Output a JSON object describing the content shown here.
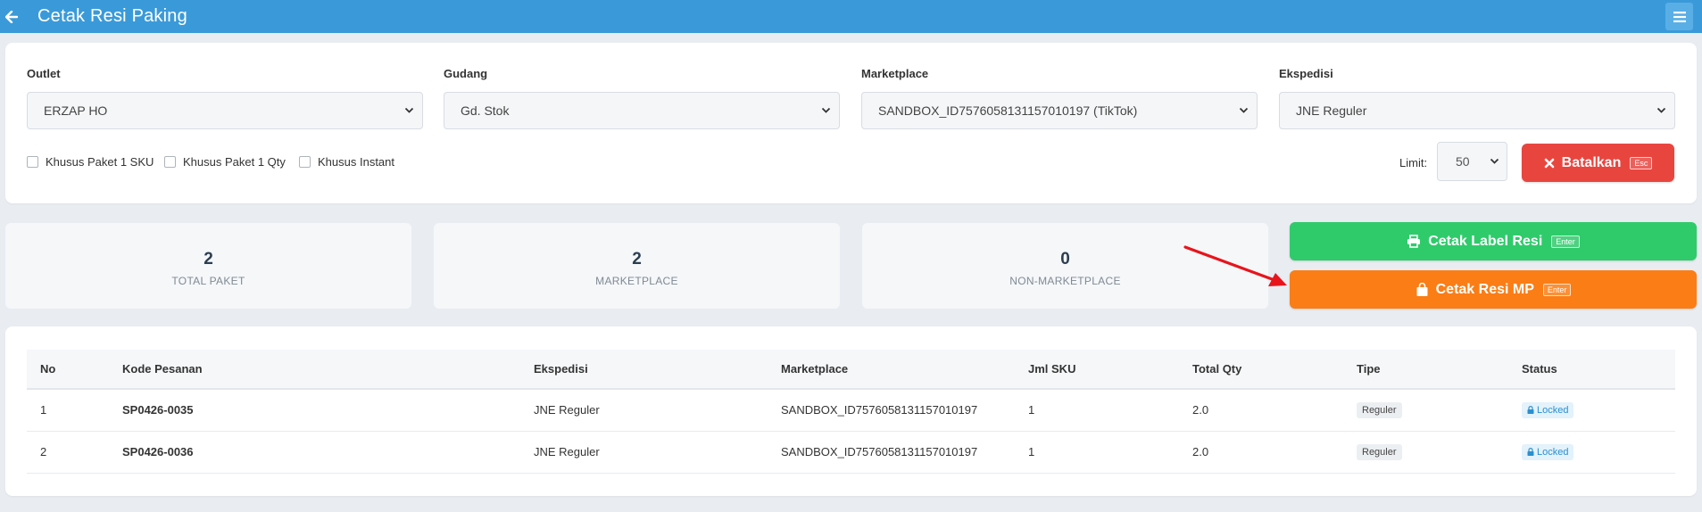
{
  "header": {
    "title": "Cetak Resi Paking"
  },
  "filters": {
    "outlet": {
      "label": "Outlet",
      "value": "ERZAP HO"
    },
    "gudang": {
      "label": "Gudang",
      "value": "Gd. Stok"
    },
    "marketplace": {
      "label": "Marketplace",
      "value": "SANDBOX_ID7576058131157010197 (TikTok)"
    },
    "ekspedisi": {
      "label": "Ekspedisi",
      "value": "JNE Reguler"
    },
    "checkboxes": {
      "sku": "Khusus Paket 1 SKU",
      "qty": "Khusus Paket 1 Qty",
      "instant": "Khusus Instant"
    },
    "limit": {
      "label": "Limit:",
      "value": "50"
    }
  },
  "buttons": {
    "batalkan": {
      "label": "Batalkan",
      "key": "Esc",
      "color": "#e9453f"
    },
    "cetak_label": {
      "label": "Cetak Label Resi",
      "key": "Enter",
      "color": "#2fcb6b"
    },
    "cetak_mp": {
      "label": "Cetak Resi MP",
      "key": "Enter",
      "color": "#fb7d15"
    }
  },
  "stats": {
    "total_paket": {
      "value": "2",
      "label": "TOTAL PAKET"
    },
    "marketplace": {
      "value": "2",
      "label": "MARKETPLACE"
    },
    "non_marketplace": {
      "value": "0",
      "label": "NON-MARKETPLACE"
    }
  },
  "table": {
    "columns": [
      "No",
      "Kode Pesanan",
      "Ekspedisi",
      "Marketplace",
      "Jml SKU",
      "Total Qty",
      "Tipe",
      "Status"
    ],
    "rows": [
      {
        "no": "1",
        "kode": "SP0426-0035",
        "ekspedisi": "JNE Reguler",
        "marketplace": "SANDBOX_ID7576058131157010197",
        "jml_sku": "1",
        "total_qty": "2.0",
        "tipe": "Reguler",
        "status": "Locked"
      },
      {
        "no": "2",
        "kode": "SP0426-0036",
        "ekspedisi": "JNE Reguler",
        "marketplace": "SANDBOX_ID7576058131157010197",
        "jml_sku": "1",
        "total_qty": "2.0",
        "tipe": "Reguler",
        "status": "Locked"
      }
    ]
  },
  "colors": {
    "header_bg": "#3a9ad9",
    "annotation_arrow": "#e8141c",
    "locked_badge": "#2a8fd0"
  },
  "icons": {
    "back": "arrow-left-icon",
    "menu": "hamburger-menu-icon",
    "batalkan": "close-icon",
    "cetak_label": "printer-icon",
    "cetak_mp": "shopping-bag-icon",
    "status": "lock-icon"
  }
}
